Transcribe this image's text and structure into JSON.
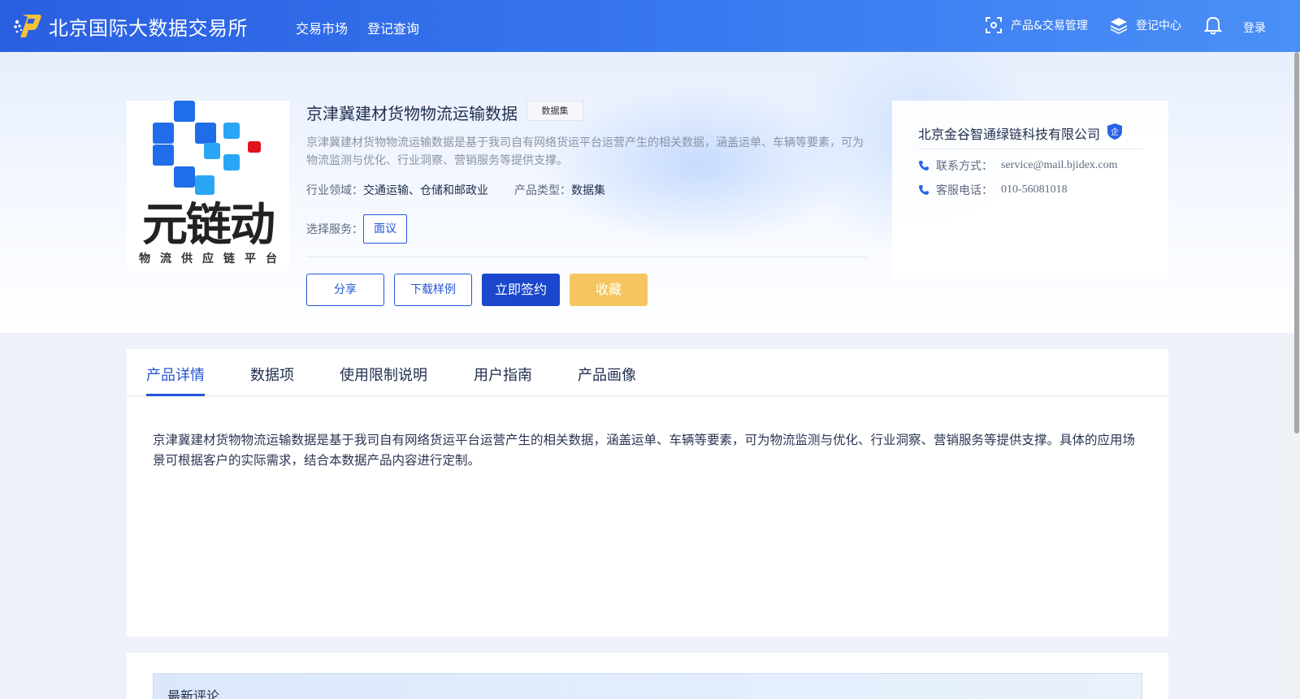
{
  "header": {
    "brand_name": "北京国际大数据交易所",
    "nav": {
      "market": "交易市场",
      "query": "登记查询"
    },
    "right": {
      "products": "产品&交易管理",
      "register_center": "登记中心",
      "login": "登录"
    }
  },
  "product": {
    "title": "京津冀建材货物物流运输数据",
    "tag": "数据集",
    "description": "京津冀建材货物物流运输数据是基于我司自有网络货运平台运营产生的相关数据，涵盖运单、车辆等要素，可为物流监测与优化、行业洞察、营销服务等提供支撑。",
    "industry_label": "行业领域：",
    "industry_value": "交通运输、仓储和邮政业",
    "type_label": "产品类型：",
    "type_value": "数据集",
    "service_label": "选择服务：",
    "service_option": "面议",
    "logo": {
      "main_text": "元链动",
      "sub_text": "物流供应链平台"
    }
  },
  "actions": {
    "share": "分享",
    "download": "下载样例",
    "sign": "立即签约",
    "favorite": "收藏"
  },
  "company": {
    "name": "北京金谷智通绿链科技有限公司",
    "badge": "企",
    "email_label": "联系方式：",
    "email": "service@mail.bjidex.com",
    "phone_label": "客服电话：",
    "phone": "010-56081018"
  },
  "tabs": [
    "产品详情",
    "数据项",
    "使用限制说明",
    "用户指南",
    "产品画像"
  ],
  "detail_text": "京津冀建材货物物流运输数据是基于我司自有网络货运平台运营产生的相关数据，涵盖运单、车辆等要素，可为物流监测与优化、行业洞察、营销服务等提供支撑。具体的应用场景可根据客户的实际需求，结合本数据产品内容进行定制。",
  "comments": {
    "title": "最新评论"
  },
  "colors": {
    "primary": "#2456d8",
    "sign": "#1a47cc",
    "favorite": "#f5c560"
  }
}
